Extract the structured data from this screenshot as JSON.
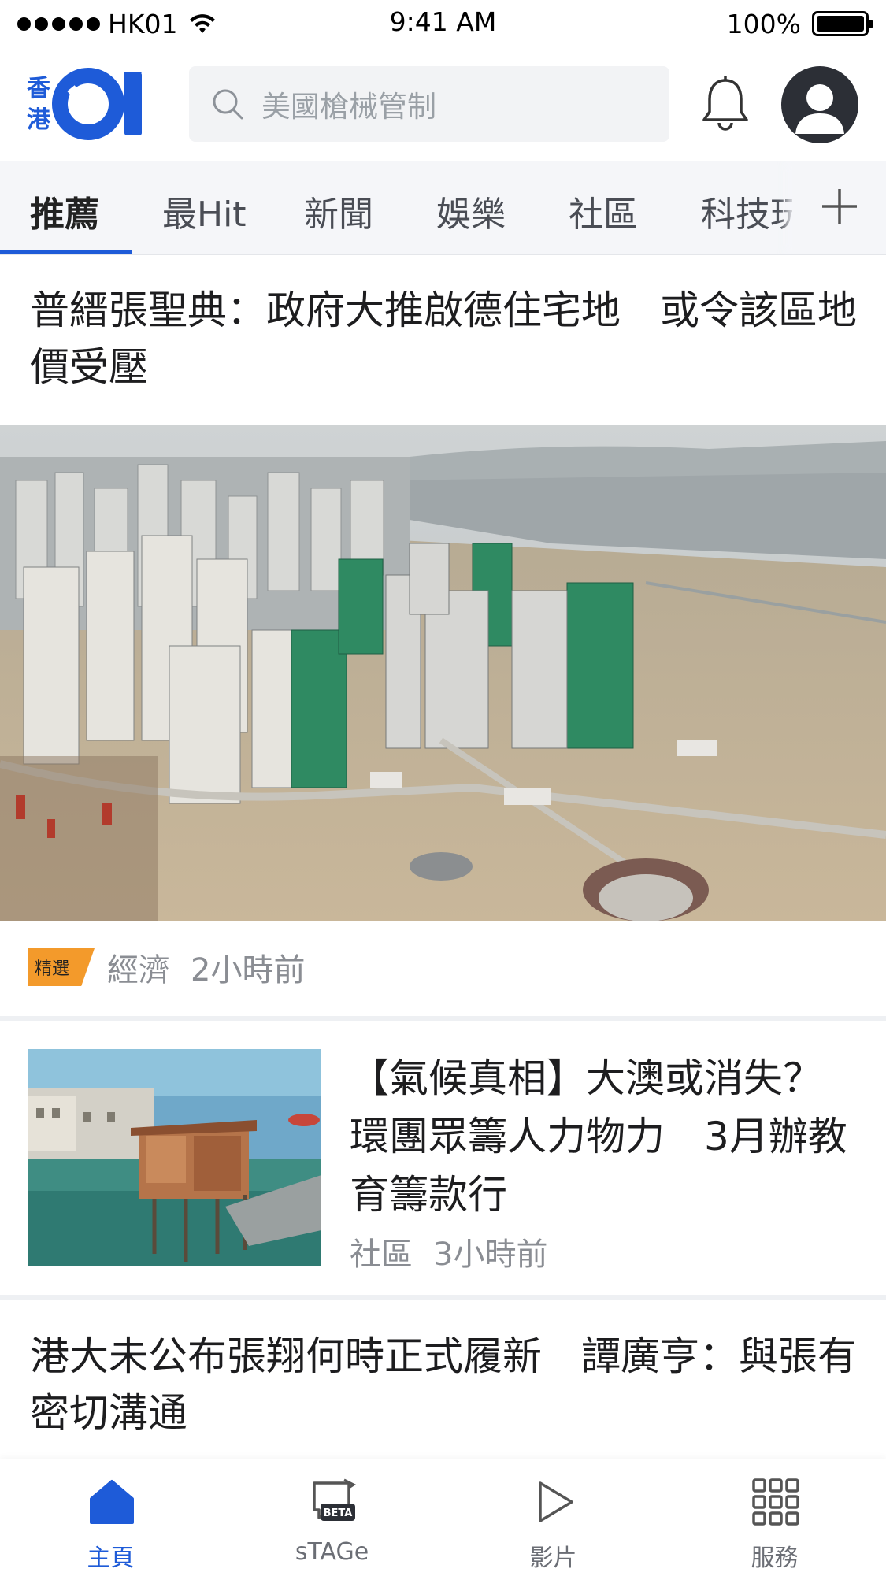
{
  "status_bar": {
    "carrier": "HK01",
    "time": "9:41 AM",
    "battery": "100%"
  },
  "header": {
    "logo_text": "香港01",
    "search_placeholder": "美國槍械管制"
  },
  "tabs": [
    {
      "label": "推薦",
      "active": true
    },
    {
      "label": "最Hit"
    },
    {
      "label": "新聞"
    },
    {
      "label": "娛樂"
    },
    {
      "label": "社區"
    },
    {
      "label": "科技玩"
    }
  ],
  "articles": [
    {
      "title": "普縉張聖典：政府大推啟德住宅地　或令該區地價受壓",
      "badge": "精選",
      "category": "經濟",
      "time": "2小時前"
    },
    {
      "title": "【氣候真相】大澳或消失？環團眾籌人力物力　3月辦教育籌款行",
      "category": "社區",
      "time": "3小時前"
    },
    {
      "title": "港大未公布張翔何時正式履新　譚廣亨：與張有密切溝通"
    }
  ],
  "bottom_nav": [
    {
      "label": "主頁",
      "icon": "home-icon",
      "active": true
    },
    {
      "label": "sTAGe",
      "icon": "stage-icon",
      "tag": "BETA"
    },
    {
      "label": "影片",
      "icon": "play-icon"
    },
    {
      "label": "服務",
      "icon": "grid-icon"
    }
  ],
  "colors": {
    "accent": "#1e5bd8",
    "badge": "#f39a2b",
    "meta": "#8a8d93"
  }
}
